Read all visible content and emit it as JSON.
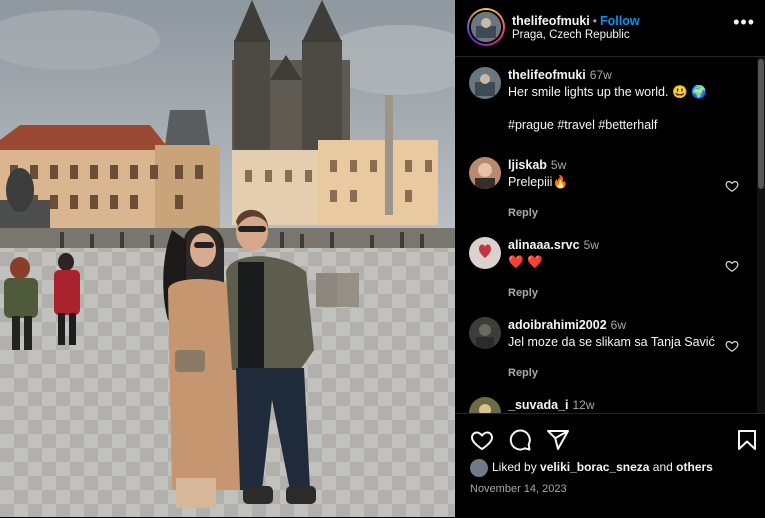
{
  "post": {
    "username": "thelifeofmuki",
    "follow_label": "Follow",
    "location": "Praga, Czech Republic",
    "more_icon": "more-horizontal-icon"
  },
  "caption": {
    "username": "thelifeofmuki",
    "time": "67w",
    "text": "Her smile lights up the world. 😃 🌍",
    "hashtags": "#prague #travel #betterhalf"
  },
  "comments": [
    {
      "username": "ljiskab",
      "time": "5w",
      "text": "Prelepiii🔥",
      "reply": "Reply"
    },
    {
      "username": "alinaaa.srvc",
      "time": "5w",
      "text": "❤️ ❤️",
      "reply": "Reply"
    },
    {
      "username": "adoibrahimi2002",
      "time": "6w",
      "text": "Jel moze da se slikam sa Tanja Savić",
      "reply": "Reply"
    },
    {
      "username": "_suvada_i",
      "time": "12w",
      "text": "",
      "reply": ""
    }
  ],
  "actions": {
    "liked_prefix": "Liked by",
    "liked_user": "veliki_borac_sneza",
    "liked_and": "and",
    "liked_others": "others",
    "date": "November 14, 2023"
  }
}
